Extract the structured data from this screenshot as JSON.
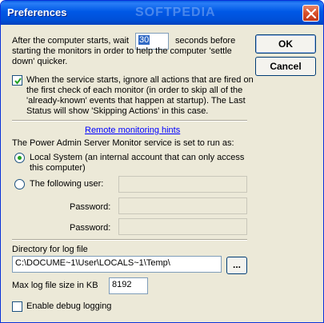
{
  "window": {
    "title": "Preferences",
    "watermark": "SOFTPEDIA"
  },
  "buttons": {
    "ok": "OK",
    "cancel": "Cancel",
    "browse": "..."
  },
  "startup": {
    "label_prefix": "After the computer starts, wait",
    "wait_seconds": "30",
    "label_suffix_line1": "seconds before",
    "label_line2": "starting the monitors in order to help the computer 'settle",
    "label_line3": "down' quicker."
  },
  "ignore_actions": {
    "checked": true,
    "line1": "When the service starts, ignore all actions that are fired on",
    "line2": "the first check of each monitor (in order to skip all of the",
    "line3": "'already-known' events that happen at startup).  The Last",
    "line4": "Status will show 'Skipping Actions' in this case."
  },
  "remote": {
    "hints_link": "Remote monitoring hints",
    "run_as_label": "The Power Admin Server Monitor service is set to run as:",
    "local_system_line1": "Local System (an internal account that can only access",
    "local_system_line2": "this computer)",
    "local_system_selected": true,
    "following_user_label": "The following user:",
    "user_value": "",
    "password_label": "Password:",
    "password_value": "",
    "password2_label": "Password:",
    "password2_value": ""
  },
  "log": {
    "directory_label": "Directory for log file",
    "directory_value": "C:\\DOCUME~1\\User\\LOCALS~1\\Temp\\",
    "max_size_label": "Max log file size in KB",
    "max_size_value": "8192",
    "debug_label": "Enable debug logging",
    "debug_checked": false
  }
}
